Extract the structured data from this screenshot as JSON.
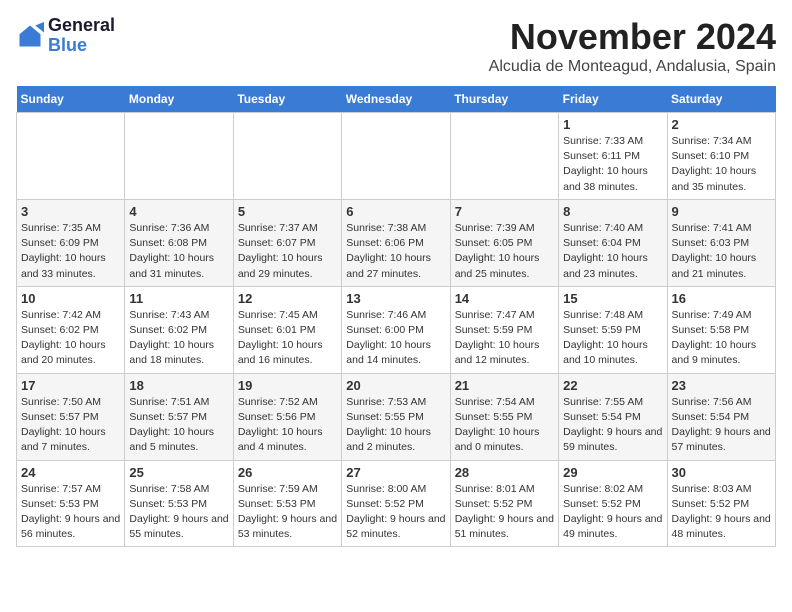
{
  "header": {
    "logo": {
      "line1": "General",
      "line2": "Blue"
    },
    "title": "November 2024",
    "subtitle": "Alcudia de Monteagud, Andalusia, Spain"
  },
  "weekdays": [
    "Sunday",
    "Monday",
    "Tuesday",
    "Wednesday",
    "Thursday",
    "Friday",
    "Saturday"
  ],
  "weeks": [
    [
      {
        "day": "",
        "info": ""
      },
      {
        "day": "",
        "info": ""
      },
      {
        "day": "",
        "info": ""
      },
      {
        "day": "",
        "info": ""
      },
      {
        "day": "",
        "info": ""
      },
      {
        "day": "1",
        "info": "Sunrise: 7:33 AM\nSunset: 6:11 PM\nDaylight: 10 hours and 38 minutes."
      },
      {
        "day": "2",
        "info": "Sunrise: 7:34 AM\nSunset: 6:10 PM\nDaylight: 10 hours and 35 minutes."
      }
    ],
    [
      {
        "day": "3",
        "info": "Sunrise: 7:35 AM\nSunset: 6:09 PM\nDaylight: 10 hours and 33 minutes."
      },
      {
        "day": "4",
        "info": "Sunrise: 7:36 AM\nSunset: 6:08 PM\nDaylight: 10 hours and 31 minutes."
      },
      {
        "day": "5",
        "info": "Sunrise: 7:37 AM\nSunset: 6:07 PM\nDaylight: 10 hours and 29 minutes."
      },
      {
        "day": "6",
        "info": "Sunrise: 7:38 AM\nSunset: 6:06 PM\nDaylight: 10 hours and 27 minutes."
      },
      {
        "day": "7",
        "info": "Sunrise: 7:39 AM\nSunset: 6:05 PM\nDaylight: 10 hours and 25 minutes."
      },
      {
        "day": "8",
        "info": "Sunrise: 7:40 AM\nSunset: 6:04 PM\nDaylight: 10 hours and 23 minutes."
      },
      {
        "day": "9",
        "info": "Sunrise: 7:41 AM\nSunset: 6:03 PM\nDaylight: 10 hours and 21 minutes."
      }
    ],
    [
      {
        "day": "10",
        "info": "Sunrise: 7:42 AM\nSunset: 6:02 PM\nDaylight: 10 hours and 20 minutes."
      },
      {
        "day": "11",
        "info": "Sunrise: 7:43 AM\nSunset: 6:02 PM\nDaylight: 10 hours and 18 minutes."
      },
      {
        "day": "12",
        "info": "Sunrise: 7:45 AM\nSunset: 6:01 PM\nDaylight: 10 hours and 16 minutes."
      },
      {
        "day": "13",
        "info": "Sunrise: 7:46 AM\nSunset: 6:00 PM\nDaylight: 10 hours and 14 minutes."
      },
      {
        "day": "14",
        "info": "Sunrise: 7:47 AM\nSunset: 5:59 PM\nDaylight: 10 hours and 12 minutes."
      },
      {
        "day": "15",
        "info": "Sunrise: 7:48 AM\nSunset: 5:59 PM\nDaylight: 10 hours and 10 minutes."
      },
      {
        "day": "16",
        "info": "Sunrise: 7:49 AM\nSunset: 5:58 PM\nDaylight: 10 hours and 9 minutes."
      }
    ],
    [
      {
        "day": "17",
        "info": "Sunrise: 7:50 AM\nSunset: 5:57 PM\nDaylight: 10 hours and 7 minutes."
      },
      {
        "day": "18",
        "info": "Sunrise: 7:51 AM\nSunset: 5:57 PM\nDaylight: 10 hours and 5 minutes."
      },
      {
        "day": "19",
        "info": "Sunrise: 7:52 AM\nSunset: 5:56 PM\nDaylight: 10 hours and 4 minutes."
      },
      {
        "day": "20",
        "info": "Sunrise: 7:53 AM\nSunset: 5:55 PM\nDaylight: 10 hours and 2 minutes."
      },
      {
        "day": "21",
        "info": "Sunrise: 7:54 AM\nSunset: 5:55 PM\nDaylight: 10 hours and 0 minutes."
      },
      {
        "day": "22",
        "info": "Sunrise: 7:55 AM\nSunset: 5:54 PM\nDaylight: 9 hours and 59 minutes."
      },
      {
        "day": "23",
        "info": "Sunrise: 7:56 AM\nSunset: 5:54 PM\nDaylight: 9 hours and 57 minutes."
      }
    ],
    [
      {
        "day": "24",
        "info": "Sunrise: 7:57 AM\nSunset: 5:53 PM\nDaylight: 9 hours and 56 minutes."
      },
      {
        "day": "25",
        "info": "Sunrise: 7:58 AM\nSunset: 5:53 PM\nDaylight: 9 hours and 55 minutes."
      },
      {
        "day": "26",
        "info": "Sunrise: 7:59 AM\nSunset: 5:53 PM\nDaylight: 9 hours and 53 minutes."
      },
      {
        "day": "27",
        "info": "Sunrise: 8:00 AM\nSunset: 5:52 PM\nDaylight: 9 hours and 52 minutes."
      },
      {
        "day": "28",
        "info": "Sunrise: 8:01 AM\nSunset: 5:52 PM\nDaylight: 9 hours and 51 minutes."
      },
      {
        "day": "29",
        "info": "Sunrise: 8:02 AM\nSunset: 5:52 PM\nDaylight: 9 hours and 49 minutes."
      },
      {
        "day": "30",
        "info": "Sunrise: 8:03 AM\nSunset: 5:52 PM\nDaylight: 9 hours and 48 minutes."
      }
    ]
  ]
}
